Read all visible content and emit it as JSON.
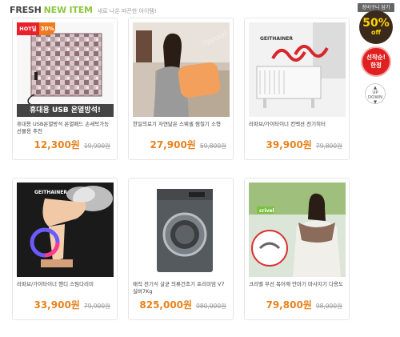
{
  "header": {
    "brand_fresh": "FRESH",
    "brand_new_item": "NEW ITEM",
    "tagline": "새로 나온 따끈한 아이템!"
  },
  "side": {
    "label": "장바구니 담기",
    "discount_big": "50%",
    "discount_small": "off",
    "limited_line1": "선착순!",
    "limited_line2": "한정",
    "up": "UP",
    "down": "DOWN"
  },
  "products": [
    {
      "name": "휴대용 USB온열방석 온열패드 손세탁가능 선물용 추천",
      "price": "12,300원",
      "original_price": "19,900원",
      "hot": "HOT딜",
      "discount": "30%",
      "banner": "휴대용 USB 온열방석!"
    },
    {
      "name": "한일의료기 자연닮은 스웨셀 찜질기 소형",
      "price": "27,900원",
      "original_price": "59,800원",
      "photo_text": "Special"
    },
    {
      "name": "라파브/가이타이너 컨벡션 전기히터",
      "price": "39,900원",
      "original_price": "79,800원",
      "logo": "GEITHAINER"
    },
    {
      "name": "라파브/가이타이너 핸디 스팀다리미",
      "price": "33,900원",
      "original_price": "79,900원",
      "logo": "GEITHAINER"
    },
    {
      "name": "매직 전기식 살균 의류건조기 프리미엄 V7 실버7Kg",
      "price": "825,000원",
      "original_price": "980,000원"
    },
    {
      "name": "크리벨 무선 목어깨 안마기 마사지기 다용도",
      "price": "79,800원",
      "original_price": "98,000원",
      "logo": "crivel"
    }
  ],
  "colors": {
    "accent_green": "#8dc63f",
    "price_orange": "#e8821e",
    "hot_red": "#e8222b"
  }
}
